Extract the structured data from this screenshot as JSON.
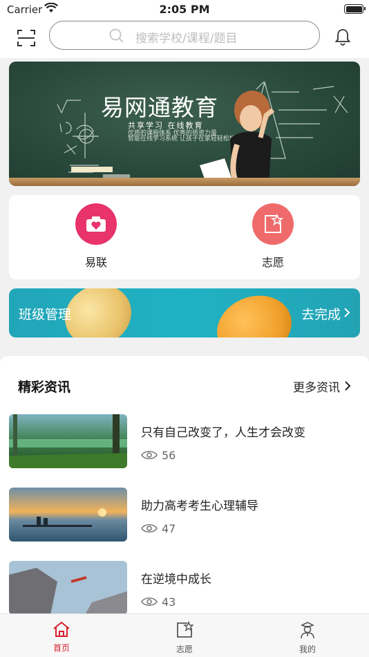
{
  "status": {
    "carrier": "Carrier",
    "time": "2:05 PM"
  },
  "search": {
    "placeholder": "搜索学校/课程/题目"
  },
  "banner": {
    "brand": "易网通教育",
    "subtitle": "共享学习 在线教育"
  },
  "quick": [
    {
      "label": "易联",
      "icon": "camera-heart-icon",
      "color": "#e8336b"
    },
    {
      "label": "志愿",
      "icon": "star-square-icon",
      "color": "#ef6b6b"
    }
  ],
  "class_bar": {
    "title": "班级管理",
    "action": "去完成"
  },
  "news": {
    "header": "精彩资讯",
    "more": "更多资讯",
    "items": [
      {
        "title": "只有自己改变了，人生才会改变",
        "views": "56"
      },
      {
        "title": "助力高考考生心理辅导",
        "views": "47"
      },
      {
        "title": "在逆境中成长",
        "views": "43"
      }
    ]
  },
  "tabs": [
    {
      "label": "首页",
      "icon": "home-icon",
      "active": true
    },
    {
      "label": "志愿",
      "icon": "star-square-icon",
      "active": false
    },
    {
      "label": "我的",
      "icon": "user-graduate-icon",
      "active": false
    }
  ],
  "colors": {
    "accent": "#d81e2c",
    "teal": "#1fb2c4"
  }
}
